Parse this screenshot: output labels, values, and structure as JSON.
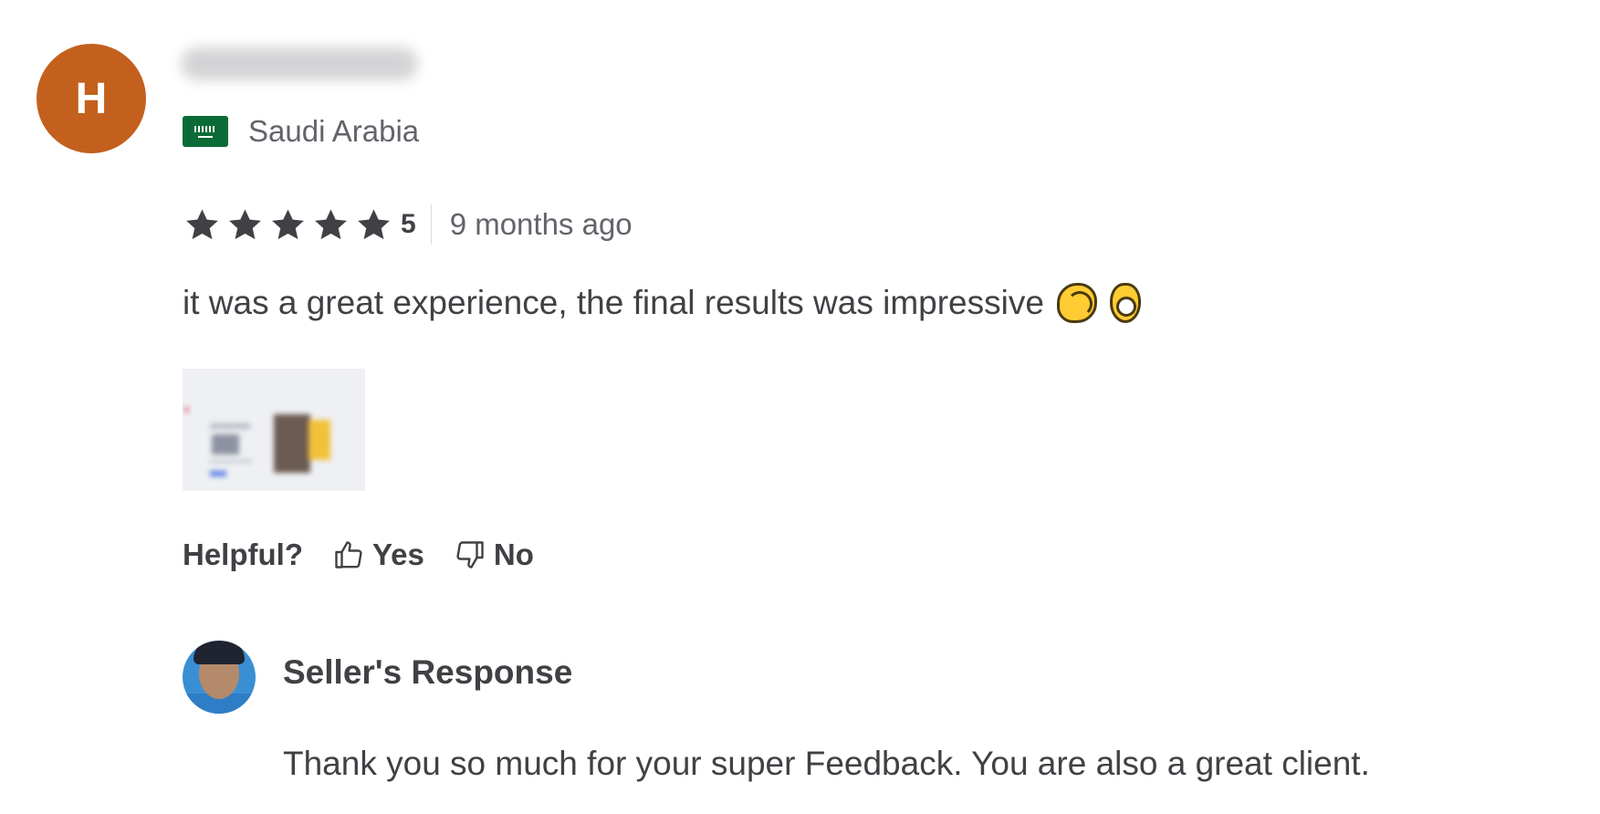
{
  "review": {
    "avatar_initial": "H",
    "avatar_color": "#c4601d",
    "country": "Saudi Arabia",
    "flag_icon": "saudi-arabia-flag-icon",
    "rating": {
      "stars": 5,
      "max_stars": 5,
      "value_label": "5",
      "star_color": "#404145"
    },
    "time_ago": "9 months ago",
    "text": "it was a great experience, the final results was impressive",
    "emojis": [
      "clapping-hands-emoji",
      "ok-hand-emoji"
    ]
  },
  "helpful": {
    "label": "Helpful?",
    "yes_label": "Yes",
    "no_label": "No"
  },
  "seller_response": {
    "title": "Seller's Response",
    "text": "Thank you so much for your super Feedback. You are also a great client."
  }
}
